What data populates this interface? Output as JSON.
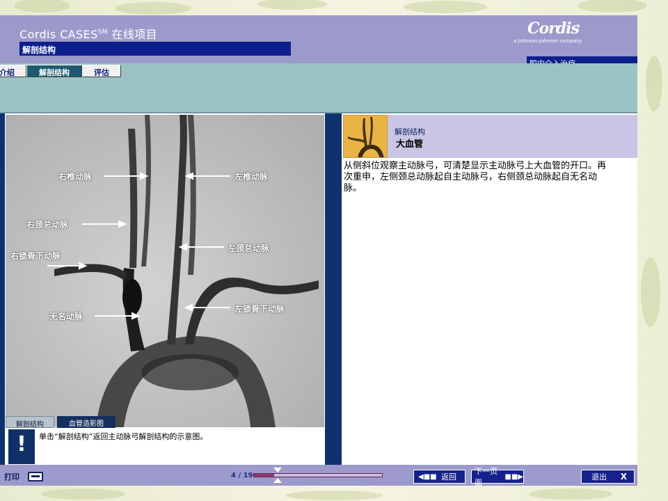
{
  "header": {
    "app_title": "Cordis CASES",
    "app_title_sup": "SM",
    "app_title_suffix": " 在线项目",
    "section_label": "解剖结构",
    "logo_main": "Cordis",
    "logo_trademark": "®",
    "logo_sub": "a Johnson-Johnson company",
    "tag_label": "腔内介入治疗"
  },
  "tabs": [
    {
      "label": "介绍"
    },
    {
      "label": "解剖结构"
    },
    {
      "label": "评估"
    }
  ],
  "angio_labels": {
    "right_vertebral": "右椎动脉",
    "left_vertebral": "左椎动脉",
    "right_common_carotid": "右颈总动脉",
    "left_common_carotid": "左颈总动脉",
    "right_subclavian": "右锁骨下动脉",
    "innominate": "无名动脉",
    "left_subclavian": "左锁骨下动脉"
  },
  "image_tabs": [
    {
      "label": "解剖结构"
    },
    {
      "label": "血管造影图"
    }
  ],
  "hint": {
    "icon": "!",
    "text": "单击“解剖结构”返回主动脉弓解剖结构的示意图。"
  },
  "info": {
    "breadcrumb": "解剖结构",
    "title": "大血管",
    "body": "从侧斜位观察主动脉弓，可清楚显示主动脉弓上大血管的开口。再次重申，左侧颈总动脉起自主动脉弓，右侧颈总动脉起自无名动脉。"
  },
  "footer": {
    "print_label": "打印",
    "page_indicator": "4 / 19",
    "progress_fraction": 0.16,
    "back_label": "返回",
    "next_label": "下一页面",
    "exit_label": "退出",
    "exit_x": "X"
  },
  "icons": {
    "print": "printer-icon",
    "back": "arrow-left-icon",
    "next": "arrow-right-icon",
    "exit": "close-icon",
    "hint": "exclamation-icon"
  },
  "colors": {
    "header": "#9c9acb",
    "navy": "#0d1f8c",
    "teal": "#9ac4c4"
  }
}
